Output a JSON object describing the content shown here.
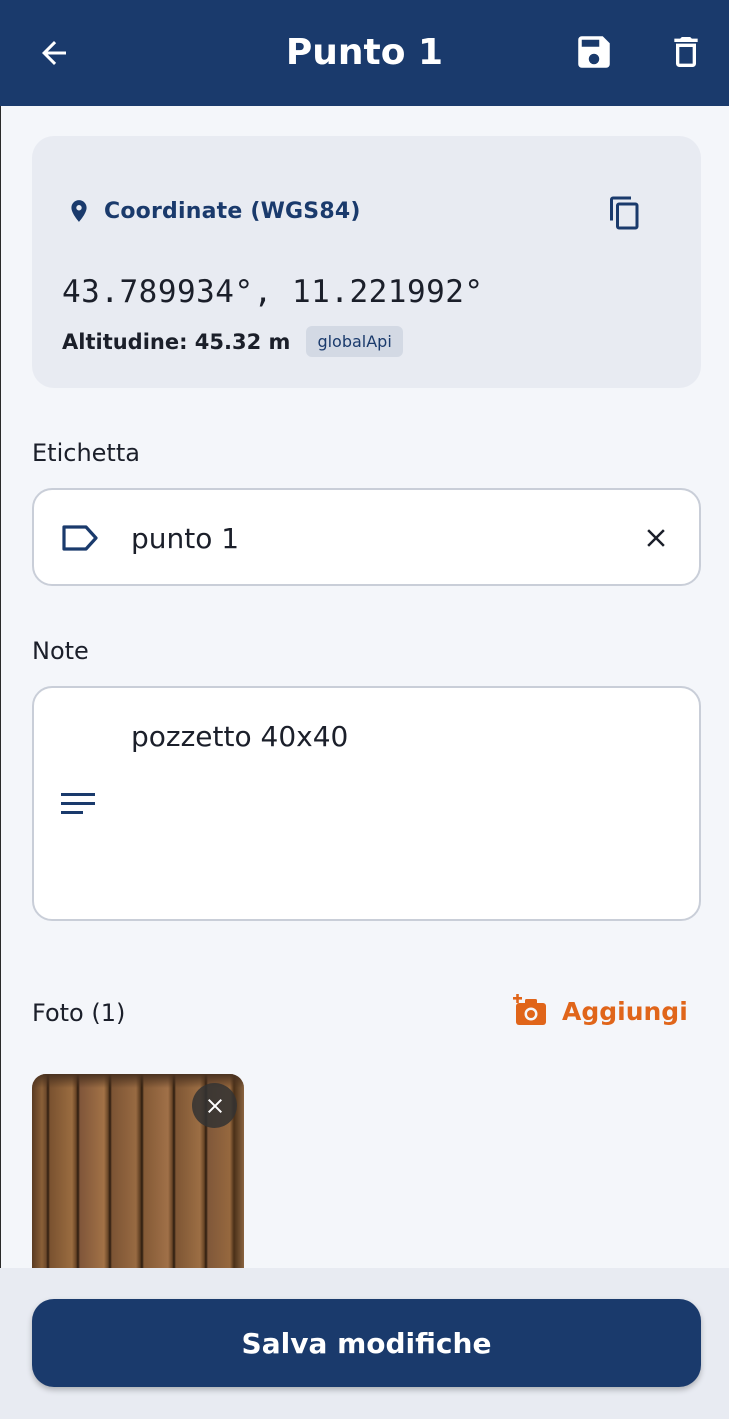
{
  "appbar": {
    "title": "Punto 1",
    "back_icon": "arrow-back-icon",
    "save_icon": "save-icon",
    "delete_icon": "delete-icon",
    "background": "#1a3a6c"
  },
  "coordinates": {
    "label": "Coordinate (WGS84)",
    "value": "43.789934°, 11.221992°",
    "altitude": "Altitudine: 45.32 m",
    "source_badge": "globalApi",
    "pin_icon": "location-pin-icon",
    "copy_icon": "copy-icon"
  },
  "label_field": {
    "section_label": "Etichetta",
    "value": "punto 1",
    "icon": "label-icon",
    "clear_icon": "close-icon"
  },
  "notes_field": {
    "section_label": "Note",
    "value": "pozzetto 40x40",
    "icon": "notes-icon"
  },
  "photos": {
    "section_label": "Foto (1)",
    "add_label": "Aggiungi",
    "add_icon": "add-photo-icon",
    "accent": "#e0651a",
    "items": [
      {
        "remove_icon": "close-icon"
      }
    ]
  },
  "footer": {
    "save_label": "Salva modifiche"
  }
}
